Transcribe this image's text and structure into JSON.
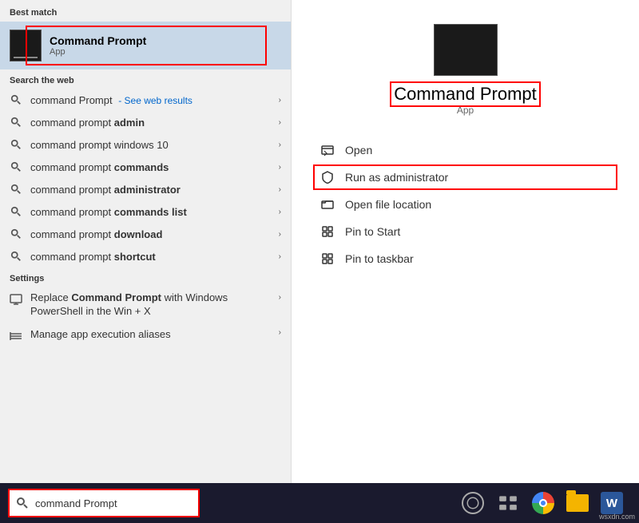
{
  "leftPanel": {
    "bestMatch": {
      "sectionLabel": "Best match",
      "appName": "Command Prompt",
      "appType": "App"
    },
    "searchWeb": {
      "sectionLabel": "Search the web",
      "items": [
        {
          "text": "command Prompt",
          "suffix": "- See web results",
          "bold": false
        },
        {
          "text": "command prompt ",
          "boldPart": "admin",
          "bold": true
        },
        {
          "text": "command prompt windows 10",
          "bold": false
        },
        {
          "text": "command prompt ",
          "boldPart": "commands",
          "bold": true
        },
        {
          "text": "command prompt ",
          "boldPart": "administrator",
          "bold": true
        },
        {
          "text": "command prompt ",
          "boldPart": "commands list",
          "bold": true
        },
        {
          "text": "command prompt ",
          "boldPart": "download",
          "bold": true
        },
        {
          "text": "command prompt ",
          "boldPart": "shortcut",
          "bold": true
        }
      ]
    },
    "settings": {
      "sectionLabel": "Settings",
      "items": [
        {
          "text": "Replace Command Prompt with Windows PowerShell in the Win + X"
        },
        {
          "text": "Manage app execution aliases"
        }
      ]
    }
  },
  "rightPanel": {
    "appName": "Command Prompt",
    "appType": "App",
    "actions": [
      {
        "label": "Open",
        "icon": "open-icon"
      },
      {
        "label": "Run as administrator",
        "icon": "shield-icon"
      },
      {
        "label": "Open file location",
        "icon": "folder-open-icon"
      },
      {
        "label": "Pin to Start",
        "icon": "pin-start-icon"
      },
      {
        "label": "Pin to taskbar",
        "icon": "pin-taskbar-icon"
      }
    ]
  },
  "taskbar": {
    "searchText": "command Prompt",
    "searchPlaceholder": "command Prompt",
    "icons": [
      {
        "name": "cortana",
        "label": "Cortana"
      },
      {
        "name": "task-view",
        "label": "Task View"
      },
      {
        "name": "chrome",
        "label": "Google Chrome"
      },
      {
        "name": "file-explorer",
        "label": "File Explorer"
      },
      {
        "name": "word",
        "label": "Microsoft Word"
      }
    ],
    "watermark": "wsxdn.com"
  }
}
